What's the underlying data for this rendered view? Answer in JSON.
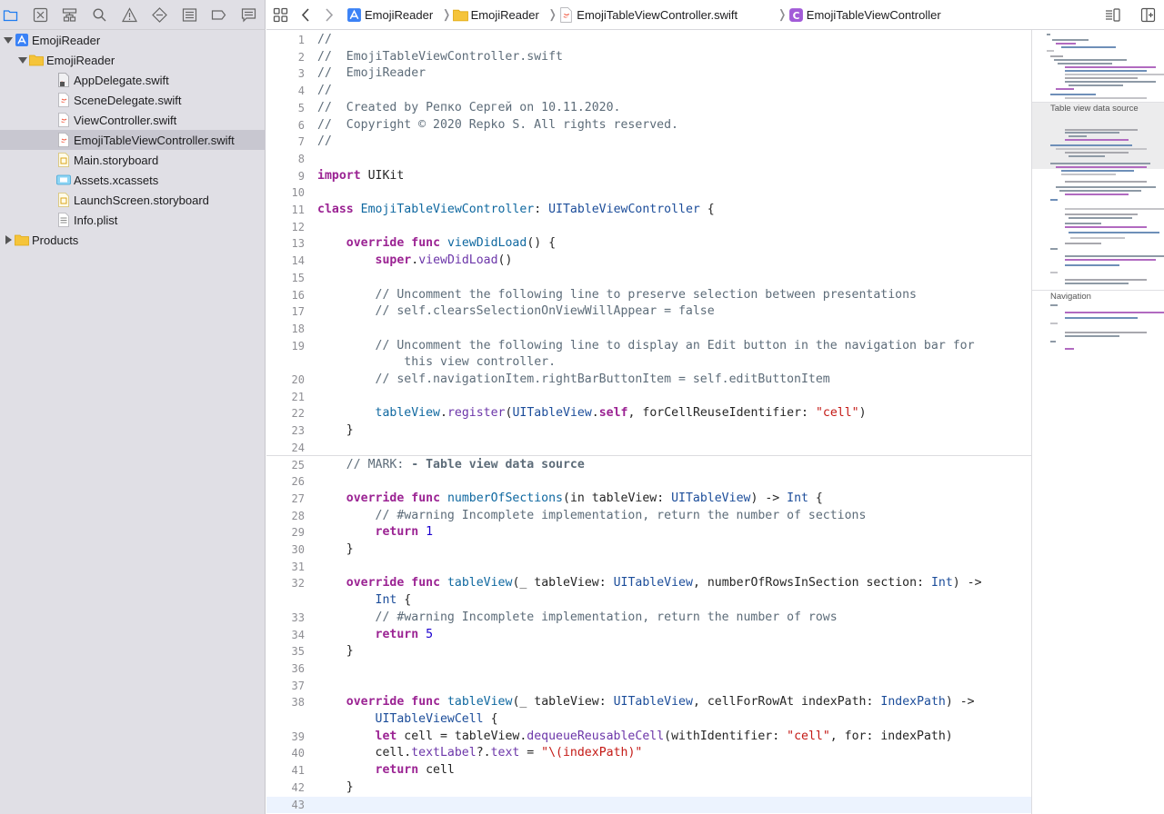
{
  "navigator": {
    "toolbar_icons": [
      "folder-icon",
      "source-control-icon",
      "hierarchy-icon",
      "find-icon",
      "warning-icon",
      "test-icon",
      "debug-icon",
      "breakpoint-icon",
      "report-icon"
    ],
    "tree": [
      {
        "label": "EmojiReader",
        "kind": "project",
        "depth": 0,
        "expanded": true
      },
      {
        "label": "EmojiReader",
        "kind": "folder",
        "depth": 1,
        "expanded": true
      },
      {
        "label": "AppDelegate.swift",
        "kind": "swift-locked",
        "depth": 2
      },
      {
        "label": "SceneDelegate.swift",
        "kind": "swift",
        "depth": 2
      },
      {
        "label": "ViewController.swift",
        "kind": "swift",
        "depth": 2
      },
      {
        "label": "EmojiTableViewController.swift",
        "kind": "swift",
        "depth": 2,
        "selected": true
      },
      {
        "label": "Main.storyboard",
        "kind": "storyboard",
        "depth": 2
      },
      {
        "label": "Assets.xcassets",
        "kind": "assets",
        "depth": 2
      },
      {
        "label": "LaunchScreen.storyboard",
        "kind": "storyboard",
        "depth": 2
      },
      {
        "label": "Info.plist",
        "kind": "plist",
        "depth": 2
      },
      {
        "label": "Products",
        "kind": "folder",
        "depth": 0,
        "expanded": false
      }
    ]
  },
  "jumpbar": {
    "crumbs": [
      {
        "label": "EmojiReader",
        "icon": "project-icon"
      },
      {
        "label": "EmojiReader",
        "icon": "folder-icon"
      },
      {
        "label": "EmojiTableViewController.swift",
        "icon": "swift-file-icon"
      },
      {
        "label": "EmojiTableViewController",
        "icon": "class-icon"
      }
    ]
  },
  "editor": {
    "current_line": 43,
    "mark_line": 25,
    "lines": [
      {
        "n": "1",
        "segs": [
          [
            "c",
            "//"
          ]
        ]
      },
      {
        "n": "2",
        "segs": [
          [
            "c",
            "//  EmojiTableViewController.swift"
          ]
        ]
      },
      {
        "n": "3",
        "segs": [
          [
            "c",
            "//  EmojiReader"
          ]
        ]
      },
      {
        "n": "4",
        "segs": [
          [
            "c",
            "//"
          ]
        ]
      },
      {
        "n": "5",
        "segs": [
          [
            "c",
            "//  Created by Репко Сергей on 10.11.2020."
          ]
        ]
      },
      {
        "n": "6",
        "segs": [
          [
            "c",
            "//  Copyright © 2020 Repko S. All rights reserved."
          ]
        ]
      },
      {
        "n": "7",
        "segs": [
          [
            "c",
            "//"
          ]
        ]
      },
      {
        "n": "8",
        "segs": []
      },
      {
        "n": "9",
        "segs": [
          [
            "k",
            "import"
          ],
          [
            "p",
            " UIKit"
          ]
        ]
      },
      {
        "n": "10",
        "segs": []
      },
      {
        "n": "11",
        "segs": [
          [
            "k",
            "class"
          ],
          [
            "p",
            " "
          ],
          [
            "d",
            "EmojiTableViewController"
          ],
          [
            "p",
            ": "
          ],
          [
            "t",
            "UITableViewController"
          ],
          [
            "p",
            " {"
          ]
        ]
      },
      {
        "n": "12",
        "segs": []
      },
      {
        "n": "13",
        "segs": [
          [
            "p",
            "    "
          ],
          [
            "k",
            "override"
          ],
          [
            "p",
            " "
          ],
          [
            "k",
            "func"
          ],
          [
            "p",
            " "
          ],
          [
            "d",
            "viewDidLoad"
          ],
          [
            "p",
            "() {"
          ]
        ]
      },
      {
        "n": "14",
        "segs": [
          [
            "p",
            "        "
          ],
          [
            "k",
            "super"
          ],
          [
            "p",
            "."
          ],
          [
            "r",
            "viewDidLoad"
          ],
          [
            "p",
            "()"
          ]
        ]
      },
      {
        "n": "15",
        "segs": []
      },
      {
        "n": "16",
        "segs": [
          [
            "p",
            "        "
          ],
          [
            "c",
            "// Uncomment the following line to preserve selection between presentations"
          ]
        ]
      },
      {
        "n": "17",
        "segs": [
          [
            "p",
            "        "
          ],
          [
            "c",
            "// self.clearsSelectionOnViewWillAppear = false"
          ]
        ]
      },
      {
        "n": "18",
        "segs": []
      },
      {
        "n": "19",
        "segs": [
          [
            "p",
            "        "
          ],
          [
            "c",
            "// Uncomment the following line to display an Edit button in the navigation bar for"
          ]
        ],
        "wrap": [
          [
            "p",
            "            "
          ],
          [
            "c",
            "this view controller."
          ]
        ]
      },
      {
        "n": "20",
        "segs": [
          [
            "p",
            "        "
          ],
          [
            "c",
            "// self.navigationItem.rightBarButtonItem = self.editButtonItem"
          ]
        ]
      },
      {
        "n": "21",
        "segs": []
      },
      {
        "n": "22",
        "segs": [
          [
            "p",
            "        "
          ],
          [
            "u",
            "tableView"
          ],
          [
            "p",
            "."
          ],
          [
            "r",
            "register"
          ],
          [
            "p",
            "("
          ],
          [
            "t",
            "UITableView"
          ],
          [
            "p",
            "."
          ],
          [
            "k",
            "self"
          ],
          [
            "p",
            ", forCellReuseIdentifier: "
          ],
          [
            "s",
            "\"cell\""
          ],
          [
            "p",
            ")"
          ]
        ]
      },
      {
        "n": "23",
        "segs": [
          [
            "p",
            "    }"
          ]
        ]
      },
      {
        "n": "24",
        "segs": []
      },
      {
        "n": "25",
        "segs": [
          [
            "p",
            "    "
          ],
          [
            "c",
            "// MARK: "
          ],
          [
            "b",
            "- Table view data source"
          ]
        ]
      },
      {
        "n": "26",
        "segs": []
      },
      {
        "n": "27",
        "segs": [
          [
            "p",
            "    "
          ],
          [
            "k",
            "override"
          ],
          [
            "p",
            " "
          ],
          [
            "k",
            "func"
          ],
          [
            "p",
            " "
          ],
          [
            "d",
            "numberOfSections"
          ],
          [
            "p",
            "(in tableView: "
          ],
          [
            "t",
            "UITableView"
          ],
          [
            "p",
            ") -> "
          ],
          [
            "t",
            "Int"
          ],
          [
            "p",
            " {"
          ]
        ]
      },
      {
        "n": "28",
        "segs": [
          [
            "p",
            "        "
          ],
          [
            "c",
            "// #warning Incomplete implementation, return the number of sections"
          ]
        ]
      },
      {
        "n": "29",
        "segs": [
          [
            "p",
            "        "
          ],
          [
            "k",
            "return"
          ],
          [
            "p",
            " "
          ],
          [
            "n",
            "1"
          ]
        ]
      },
      {
        "n": "30",
        "segs": [
          [
            "p",
            "    }"
          ]
        ]
      },
      {
        "n": "31",
        "segs": []
      },
      {
        "n": "32",
        "segs": [
          [
            "p",
            "    "
          ],
          [
            "k",
            "override"
          ],
          [
            "p",
            " "
          ],
          [
            "k",
            "func"
          ],
          [
            "p",
            " "
          ],
          [
            "d",
            "tableView"
          ],
          [
            "p",
            "(_ tableView: "
          ],
          [
            "t",
            "UITableView"
          ],
          [
            "p",
            ", numberOfRowsInSection section: "
          ],
          [
            "t",
            "Int"
          ],
          [
            "p",
            ") ->"
          ]
        ],
        "wrap": [
          [
            "p",
            "        "
          ],
          [
            "t",
            "Int"
          ],
          [
            "p",
            " {"
          ]
        ]
      },
      {
        "n": "33",
        "segs": [
          [
            "p",
            "        "
          ],
          [
            "c",
            "// #warning Incomplete implementation, return the number of rows"
          ]
        ]
      },
      {
        "n": "34",
        "segs": [
          [
            "p",
            "        "
          ],
          [
            "k",
            "return"
          ],
          [
            "p",
            " "
          ],
          [
            "n",
            "5"
          ]
        ]
      },
      {
        "n": "35",
        "segs": [
          [
            "p",
            "    }"
          ]
        ]
      },
      {
        "n": "36",
        "segs": []
      },
      {
        "n": "37",
        "segs": []
      },
      {
        "n": "38",
        "segs": [
          [
            "p",
            "    "
          ],
          [
            "k",
            "override"
          ],
          [
            "p",
            " "
          ],
          [
            "k",
            "func"
          ],
          [
            "p",
            " "
          ],
          [
            "d",
            "tableView"
          ],
          [
            "p",
            "(_ tableView: "
          ],
          [
            "t",
            "UITableView"
          ],
          [
            "p",
            ", cellForRowAt indexPath: "
          ],
          [
            "t",
            "IndexPath"
          ],
          [
            "p",
            ") ->"
          ]
        ],
        "wrap": [
          [
            "p",
            "        "
          ],
          [
            "t",
            "UITableViewCell"
          ],
          [
            "p",
            " {"
          ]
        ]
      },
      {
        "n": "39",
        "segs": [
          [
            "p",
            "        "
          ],
          [
            "k",
            "let"
          ],
          [
            "p",
            " cell = tableView."
          ],
          [
            "r",
            "dequeueReusableCell"
          ],
          [
            "p",
            "(withIdentifier: "
          ],
          [
            "s",
            "\"cell\""
          ],
          [
            "p",
            ", for: indexPath)"
          ]
        ]
      },
      {
        "n": "40",
        "segs": [
          [
            "p",
            "        cell."
          ],
          [
            "r",
            "textLabel"
          ],
          [
            "p",
            "?."
          ],
          [
            "r",
            "text"
          ],
          [
            "p",
            " = "
          ],
          [
            "s",
            "\"\\(indexPath)\""
          ]
        ]
      },
      {
        "n": "41",
        "segs": [
          [
            "p",
            "        "
          ],
          [
            "k",
            "return"
          ],
          [
            "p",
            " cell"
          ]
        ]
      },
      {
        "n": "42",
        "segs": [
          [
            "p",
            "    }"
          ]
        ]
      },
      {
        "n": "43",
        "segs": []
      }
    ]
  },
  "minimap": {
    "sections": [
      "Table view data source",
      "Navigation"
    ]
  }
}
